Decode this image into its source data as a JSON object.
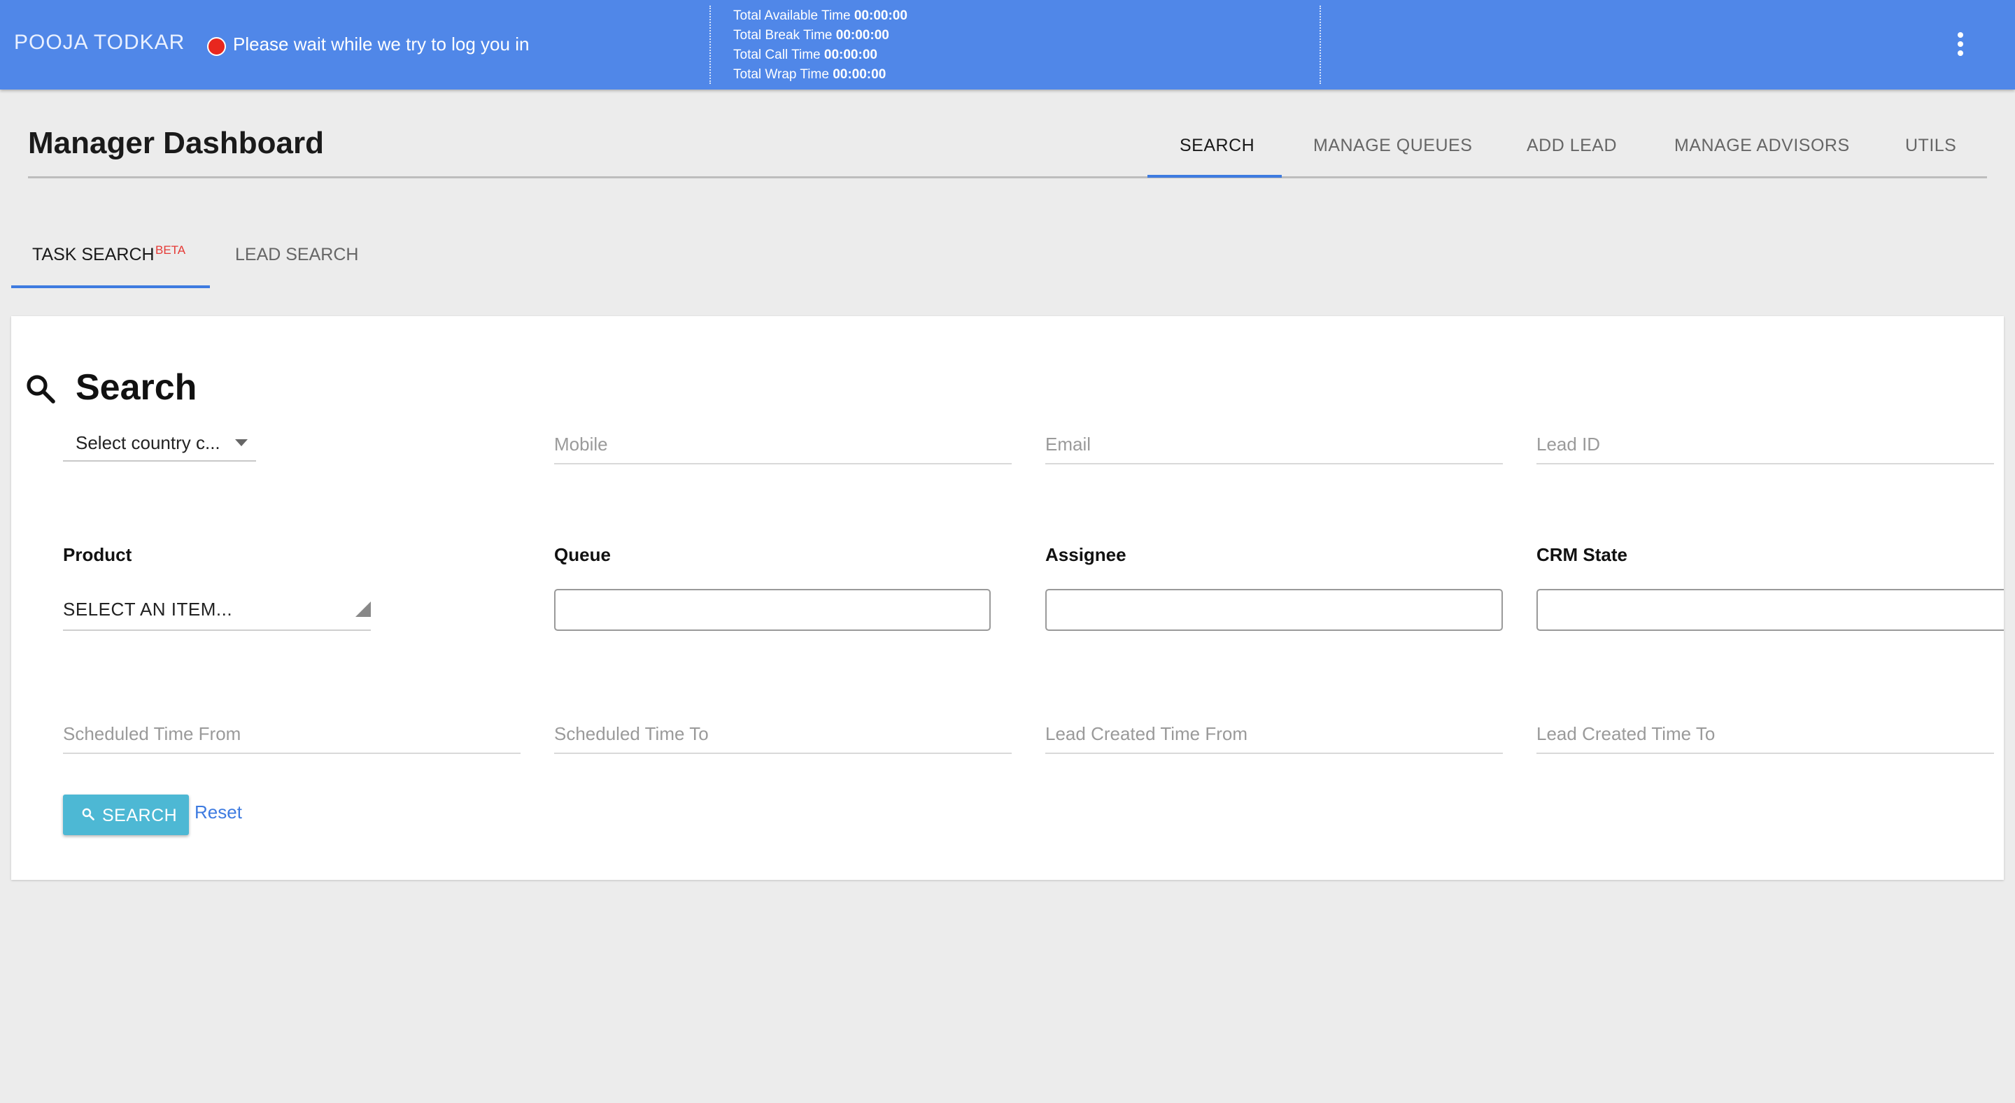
{
  "topbar": {
    "agent_name": "POOJA TODKAR",
    "status_text": "Please wait while we try to log you in",
    "status_color": "#e8271e",
    "timers": [
      {
        "label": "Total Available Time",
        "value": "00:00:00"
      },
      {
        "label": "Total Break Time",
        "value": "00:00:00"
      },
      {
        "label": "Total Call Time",
        "value": "00:00:00"
      },
      {
        "label": "Total Wrap Time",
        "value": "00:00:00"
      }
    ],
    "menu_icon": "more-vert-icon"
  },
  "header": {
    "title": "Manager Dashboard",
    "tabs": [
      {
        "label": "SEARCH",
        "active": true
      },
      {
        "label": "MANAGE QUEUES",
        "active": false
      },
      {
        "label": "ADD LEAD",
        "active": false
      },
      {
        "label": "MANAGE ADVISORS",
        "active": false
      },
      {
        "label": "UTILS",
        "active": false
      }
    ]
  },
  "subtabs": {
    "items": [
      {
        "label": "TASK SEARCH",
        "badge": "BETA",
        "active": true
      },
      {
        "label": "LEAD SEARCH",
        "active": false
      }
    ]
  },
  "search_form": {
    "title": "Search",
    "country_select": {
      "value": "Select country c..."
    },
    "mobile": {
      "placeholder": "Mobile"
    },
    "email": {
      "placeholder": "Email"
    },
    "lead_id": {
      "placeholder": "Lead ID"
    },
    "product": {
      "label": "Product",
      "value": "SELECT AN ITEM..."
    },
    "queue": {
      "label": "Queue"
    },
    "assignee": {
      "label": "Assignee"
    },
    "crm_state": {
      "label": "CRM State"
    },
    "scheduled_from": {
      "placeholder": "Scheduled Time From"
    },
    "scheduled_to": {
      "placeholder": "Scheduled Time To"
    },
    "lead_created_from": {
      "placeholder": "Lead Created Time From"
    },
    "lead_created_to": {
      "placeholder": "Lead Created Time To"
    },
    "search_button": "SEARCH",
    "reset_link": "Reset"
  },
  "colors": {
    "topbar": "#5087e8",
    "accent": "#3e7be0",
    "button": "#4db8d4",
    "beta": "#e53935"
  }
}
